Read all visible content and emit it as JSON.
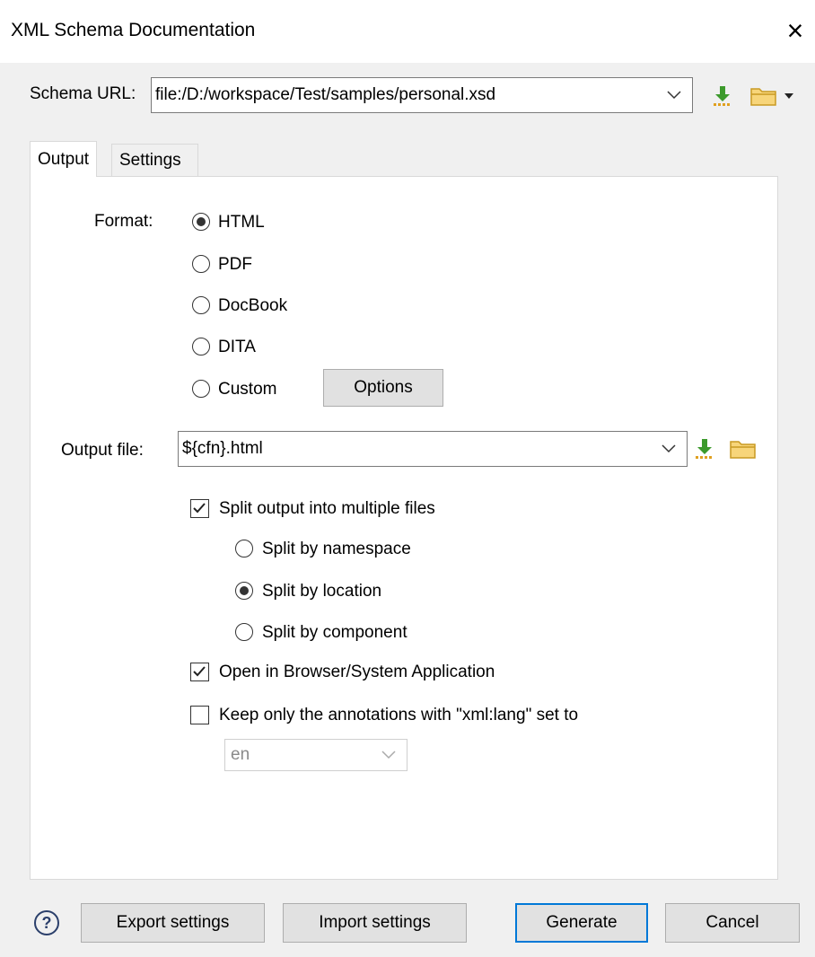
{
  "dialog": {
    "title": "XML Schema Documentation",
    "close_glyph": "×"
  },
  "schema": {
    "label": "Schema URL:",
    "value": "file:/D:/workspace/Test/samples/personal.xsd"
  },
  "tabs": [
    {
      "label": "Output",
      "selected": true
    },
    {
      "label": "Settings",
      "selected": false
    }
  ],
  "format": {
    "label": "Format:",
    "options": [
      {
        "label": "HTML",
        "selected": true
      },
      {
        "label": "PDF",
        "selected": false
      },
      {
        "label": "DocBook",
        "selected": false
      },
      {
        "label": "DITA",
        "selected": false
      },
      {
        "label": "Custom",
        "selected": false
      }
    ],
    "options_button": "Options"
  },
  "output_file": {
    "label": "Output file:",
    "value": "${cfn}.html"
  },
  "split": {
    "label": "Split output into multiple files",
    "checked": true,
    "options": [
      {
        "label": "Split by namespace",
        "selected": false
      },
      {
        "label": "Split by location",
        "selected": true
      },
      {
        "label": "Split by component",
        "selected": false
      }
    ]
  },
  "open_browser": {
    "label": "Open in Browser/System Application",
    "checked": true
  },
  "keep_annotations": {
    "label": "Keep only the annotations with \"xml:lang\" set to",
    "checked": false,
    "lang": "en"
  },
  "footer": {
    "help": "?",
    "export": "Export settings",
    "import": "Import settings",
    "generate": "Generate",
    "cancel": "Cancel"
  },
  "colors": {
    "accent": "#0078d7",
    "download_green": "#3c9a2c",
    "folder_yellow": "#e8b93a"
  },
  "icons": [
    "close-icon",
    "chevron-down-icon",
    "download-icon",
    "folder-icon",
    "dropdown-arrow-icon",
    "help-icon"
  ]
}
